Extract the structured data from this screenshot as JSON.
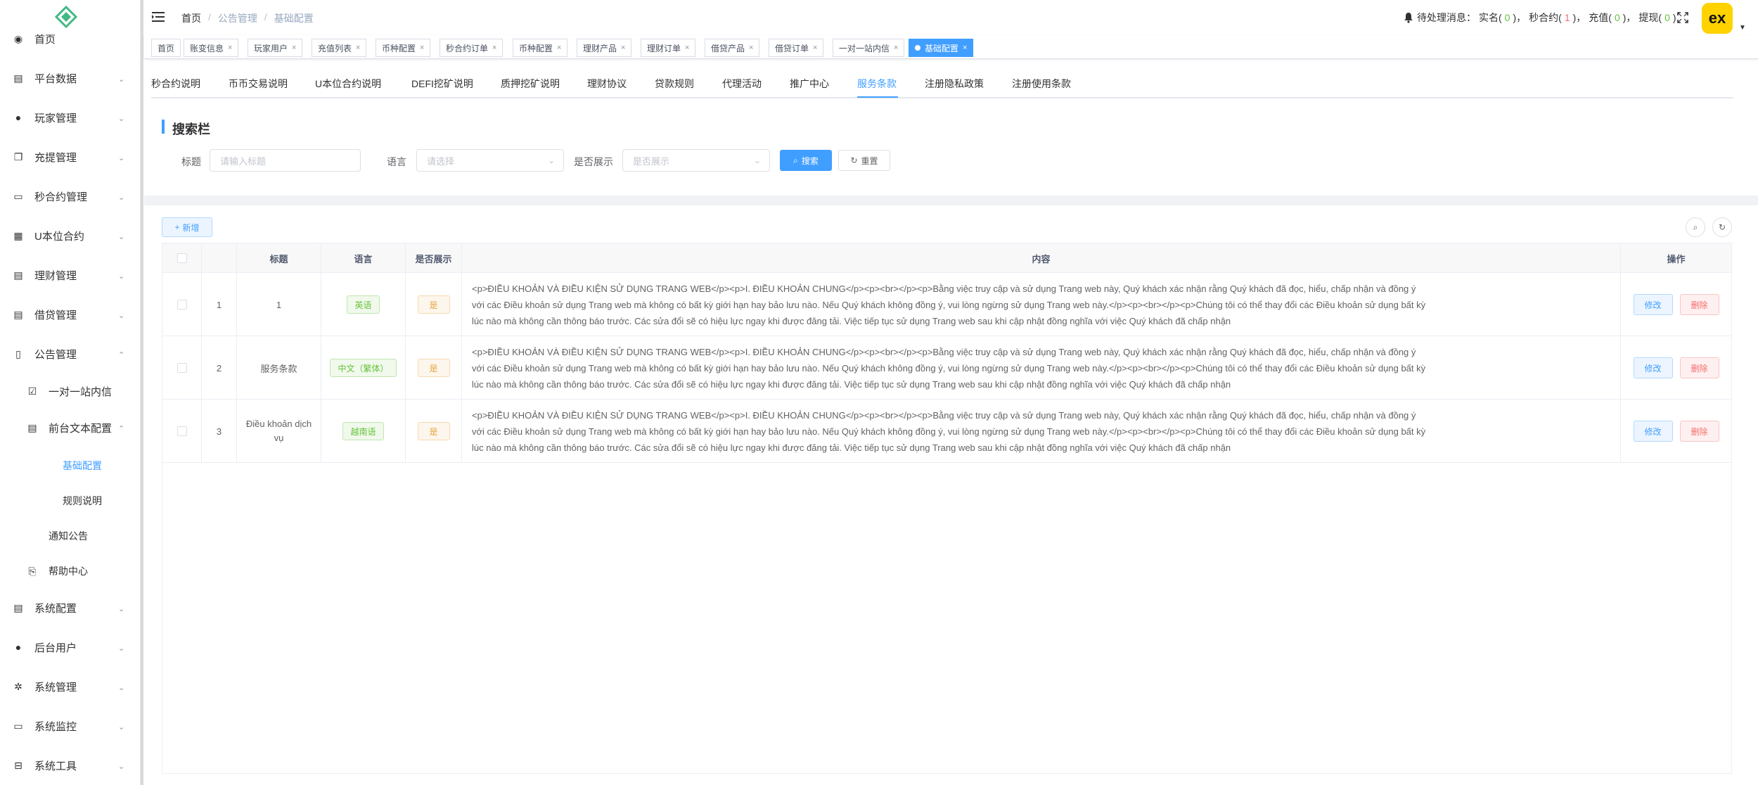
{
  "sidebar": {
    "items": [
      {
        "label": "首页",
        "icon": "dashboard-icon",
        "arrow": false
      },
      {
        "label": "平台数据",
        "icon": "book-icon",
        "arrow": true
      },
      {
        "label": "玩家管理",
        "icon": "user-icon",
        "arrow": true
      },
      {
        "label": "充提管理",
        "icon": "copy-icon",
        "arrow": true
      },
      {
        "label": "秒合约管理",
        "icon": "monitor-icon",
        "arrow": true
      },
      {
        "label": "U本位合约",
        "icon": "grid-icon",
        "arrow": true
      },
      {
        "label": "理财管理",
        "icon": "document-icon",
        "arrow": true
      },
      {
        "label": "借贷管理",
        "icon": "book-icon",
        "arrow": true
      },
      {
        "label": "公告管理",
        "icon": "reader-icon",
        "arrow": "up"
      }
    ],
    "sub_items": [
      {
        "label": "一对一站内信",
        "icon": "checkbox-icon"
      },
      {
        "label": "前台文本配置",
        "icon": "document-icon",
        "arrow": "up"
      },
      {
        "label": "基础配置",
        "active": true
      },
      {
        "label": "规则说明"
      },
      {
        "label": "通知公告"
      },
      {
        "label": "帮助中心",
        "icon": "help-icon"
      }
    ],
    "bottom_items": [
      {
        "label": "系统配置",
        "icon": "document-icon"
      },
      {
        "label": "后台用户",
        "icon": "users-icon"
      },
      {
        "label": "系统管理",
        "icon": "gear-icon"
      },
      {
        "label": "系统监控",
        "icon": "monitor-icon"
      },
      {
        "label": "系统工具",
        "icon": "toolbox-icon"
      }
    ]
  },
  "header": {
    "breadcrumb": [
      "首页",
      "公告管理",
      "基础配置"
    ],
    "notice": {
      "prefix": "待处理消息：",
      "items": [
        {
          "label": "实名(",
          "value": "0",
          "suffix": ")，",
          "color": "#67c23a"
        },
        {
          "label": "秒合约(",
          "value": "1",
          "suffix": ")，",
          "color": "#f56c6c"
        },
        {
          "label": "充值(",
          "value": "0",
          "suffix": ")，",
          "color": "#67c23a"
        },
        {
          "label": "提现(",
          "value": "0",
          "suffix": ")",
          "color": "#67c23a"
        }
      ]
    },
    "avatar_text": "ex"
  },
  "tags": [
    {
      "label": "首页",
      "closable": false
    },
    {
      "label": "账变信息",
      "closable": true
    },
    {
      "label": "玩家用户",
      "closable": true
    },
    {
      "label": "充值列表",
      "closable": true
    },
    {
      "label": "币种配置",
      "closable": true
    },
    {
      "label": "秒合约订单",
      "closable": true
    },
    {
      "label": "币种配置",
      "closable": true
    },
    {
      "label": "理财产品",
      "closable": true
    },
    {
      "label": "理财订单",
      "closable": true
    },
    {
      "label": "借贷产品",
      "closable": true
    },
    {
      "label": "借贷订单",
      "closable": true
    },
    {
      "label": "一对一站内信",
      "closable": true
    },
    {
      "label": "基础配置",
      "closable": true,
      "active": true
    }
  ],
  "content_tabs": [
    "秒合约说明",
    "币币交易说明",
    "U本位合约说明",
    "DEFI挖矿说明",
    "质押挖矿说明",
    "理财协议",
    "贷款规则",
    "代理活动",
    "推广中心",
    "服务条款",
    "注册隐私政策",
    "注册使用条款"
  ],
  "active_tab": "服务条款",
  "search": {
    "title": "搜索栏",
    "title_label": "标题",
    "title_placeholder": "请输入标题",
    "lang_label": "语言",
    "lang_placeholder": "请选择",
    "show_label": "是否展示",
    "show_placeholder": "是否展示",
    "search_btn": "搜索",
    "reset_btn": "重置"
  },
  "toolbar": {
    "add_btn": "新增"
  },
  "table": {
    "headers": [
      "标题",
      "语言",
      "是否展示",
      "内容",
      "操作"
    ],
    "rows": [
      {
        "index": "1",
        "title": "1",
        "lang": "英语",
        "show": "是",
        "content": "<p>ĐIỀU KHOẢN VÀ ĐIỀU KIỆN SỬ DỤNG TRANG WEB</p><p>I. ĐIỀU KHOẢN CHUNG</p><p><br></p><p>Bằng việc truy cập và sử dụng Trang web này, Quý khách xác nhận rằng Quý khách đã đọc, hiểu, chấp nhận và đồng ý với các Điều khoản sử dụng Trang web mà không có bất kỳ giới hạn hay bảo lưu nào. Nếu Quý khách không đồng ý, vui lòng ngừng sử dụng Trang web này.</p><p><br></p><p>Chúng tôi có thể thay đổi các Điều khoản sử dụng bất kỳ lúc nào mà không cần thông báo trước. Các sửa đổi sẽ có hiệu lực ngay khi được đăng tải. Việc tiếp tục sử dụng Trang web sau khi cập nhật đồng nghĩa với việc Quý khách đã chấp nhận"
      },
      {
        "index": "2",
        "title": "服务条款",
        "lang": "中文（繁体）",
        "show": "是",
        "content": "<p>ĐIỀU KHOẢN VÀ ĐIỀU KIỆN SỬ DỤNG TRANG WEB</p><p>I. ĐIỀU KHOẢN CHUNG</p><p><br></p><p>Bằng việc truy cập và sử dụng Trang web này, Quý khách xác nhận rằng Quý khách đã đọc, hiểu, chấp nhận và đồng ý với các Điều khoản sử dụng Trang web mà không có bất kỳ giới hạn hay bảo lưu nào. Nếu Quý khách không đồng ý, vui lòng ngừng sử dụng Trang web này.</p><p><br></p><p>Chúng tôi có thể thay đổi các Điều khoản sử dụng bất kỳ lúc nào mà không cần thông báo trước. Các sửa đổi sẽ có hiệu lực ngay khi được đăng tải. Việc tiếp tục sử dụng Trang web sau khi cập nhật đồng nghĩa với việc Quý khách đã chấp nhận"
      },
      {
        "index": "3",
        "title": "Điều khoản dịch vụ",
        "lang": "越南语",
        "show": "是",
        "content": "<p>ĐIỀU KHOẢN VÀ ĐIỀU KIỆN SỬ DỤNG TRANG WEB</p><p>I. ĐIỀU KHOẢN CHUNG</p><p><br></p><p>Bằng việc truy cập và sử dụng Trang web này, Quý khách xác nhận rằng Quý khách đã đọc, hiểu, chấp nhận và đồng ý với các Điều khoản sử dụng Trang web mà không có bất kỳ giới hạn hay bảo lưu nào. Nếu Quý khách không đồng ý, vui lòng ngừng sử dụng Trang web này.</p><p><br></p><p>Chúng tôi có thể thay đổi các Điều khoản sử dụng bất kỳ lúc nào mà không cần thông báo trước. Các sửa đổi sẽ có hiệu lực ngay khi được đăng tải. Việc tiếp tục sử dụng Trang web sau khi cập nhật đồng nghĩa với việc Quý khách đã chấp nhận"
      }
    ],
    "edit_btn": "修改",
    "delete_btn": "删除"
  }
}
